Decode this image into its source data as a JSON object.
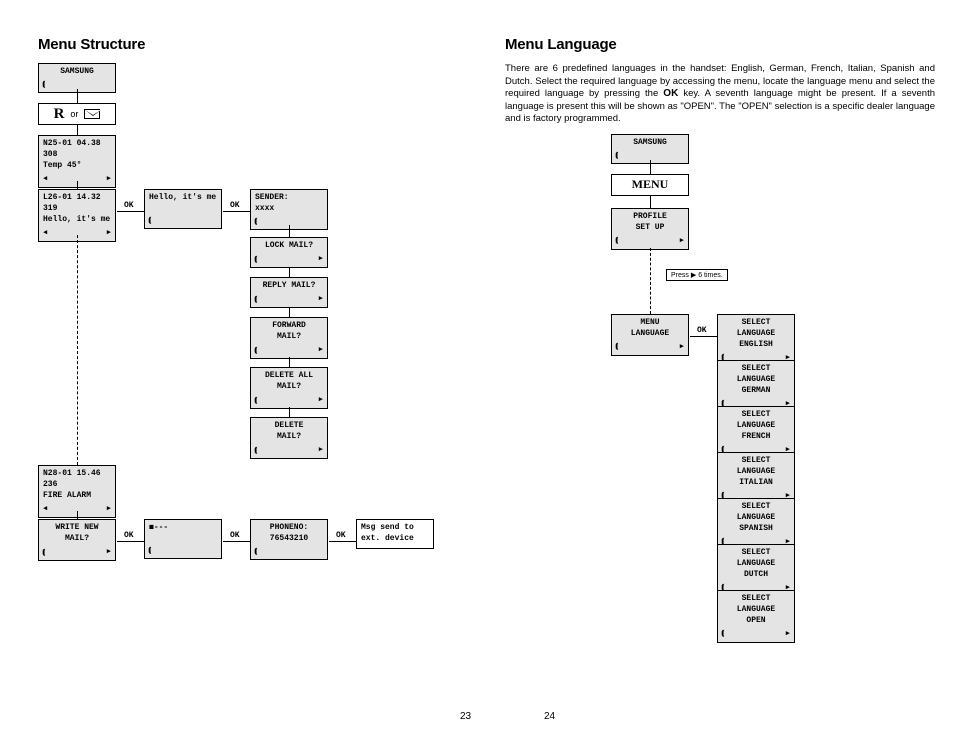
{
  "left": {
    "title": "Menu Structure",
    "samsung": "SAMSUNG",
    "r_label": "R",
    "or_label": "or",
    "box_n25": {
      "l1": "N25-01 04.38",
      "l2": "308",
      "l3": "Temp 45°"
    },
    "box_l26": {
      "l1": "L26-01 14.32",
      "l2": "319",
      "l3": "Hello, it's me"
    },
    "box_hello": "Hello, it's me",
    "box_sender": {
      "l1": "SENDER:",
      "l2": "xxxx"
    },
    "box_lock": "LOCK MAIL?",
    "box_reply": "REPLY MAIL?",
    "box_forward": {
      "l1": "FORWARD",
      "l2": "MAIL?"
    },
    "box_deleteall": {
      "l1": "DELETE ALL",
      "l2": "MAIL?"
    },
    "box_delete": {
      "l1": "DELETE",
      "l2": "MAIL?"
    },
    "box_n28": {
      "l1": "N28-01 15.46",
      "l2": "236",
      "l3": "FIRE ALARM"
    },
    "box_write": {
      "l1": "WRITE NEW",
      "l2": "MAIL?"
    },
    "box_compose": "◼---",
    "box_phoneno": {
      "l1": "PHONENO:",
      "l2": "76543210"
    },
    "box_msgsend": {
      "l1": "Msg send to",
      "l2": "ext. device"
    },
    "ok": "OK",
    "page_num": "23"
  },
  "right": {
    "title": "Menu Language",
    "para1_a": "There are 6 predefined languages in the handset: English, German, French, Italian, Spanish and Dutch. Select the required language by accessing the menu, locate the language menu and select the required language by pressing the ",
    "para1_ok": "OK",
    "para1_b": " key. A seventh language might be present. If a seventh language is present this will be shown as \"OPEN\". The \"OPEN\" selection is a specific dealer language and is factory programmed.",
    "samsung": "SAMSUNG",
    "menu_label": "MENU",
    "profile": {
      "l1": "PROFILE",
      "l2": "SET UP"
    },
    "press6_a": "Press",
    "press6_b": "6 times.",
    "menulang": {
      "l1": "MENU",
      "l2": "LANGUAGE"
    },
    "sel": "SELECT",
    "lang": "LANGUAGE",
    "english": "ENGLISH",
    "german": "GERMAN",
    "french": "FRENCH",
    "italian": "ITALIAN",
    "spanish": "SPANISH",
    "dutch": "DUTCH",
    "open": "OPEN",
    "ok": "OK",
    "page_num": "24"
  }
}
